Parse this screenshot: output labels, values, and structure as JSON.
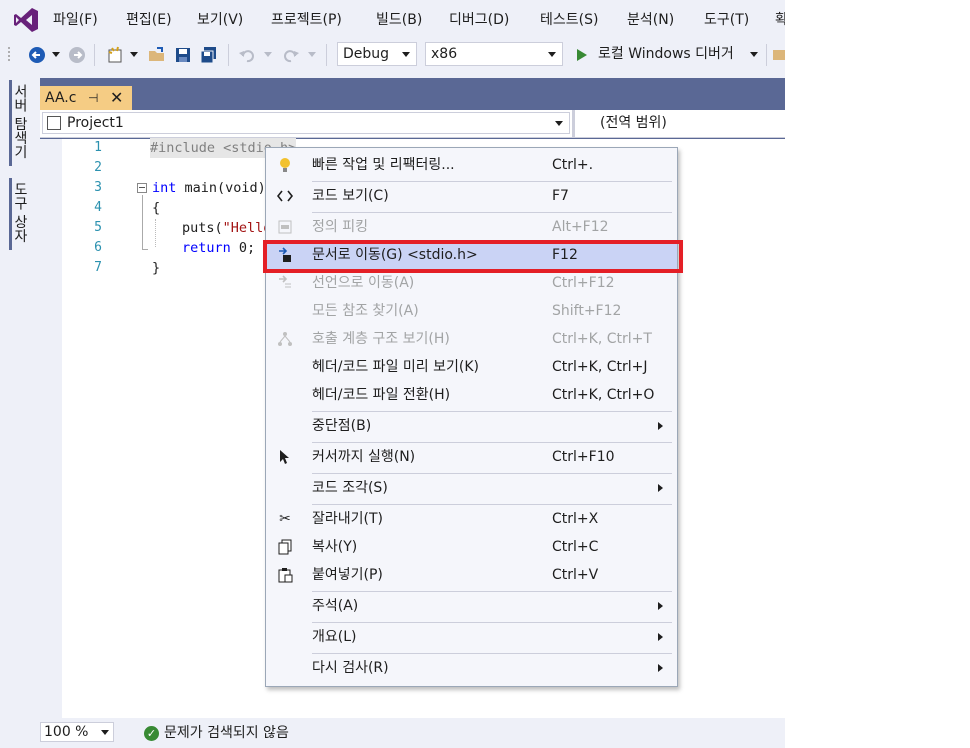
{
  "menubar": {
    "items": [
      "파일(F)",
      "편집(E)",
      "보기(V)",
      "프로젝트(P)",
      "빌드(B)",
      "디버그(D)",
      "테스트(S)",
      "분석(N)",
      "도구(T)",
      "확"
    ]
  },
  "toolbar": {
    "config": "Debug",
    "platform": "x86",
    "run_label": "로컬 Windows 디버거"
  },
  "sidebar": {
    "tabs": [
      "서버 탐색기",
      "도구 상자"
    ]
  },
  "document": {
    "tab_title": "AA.c",
    "nav_project": "Project1",
    "nav_scope": "(전역 범위)"
  },
  "editor": {
    "line_numbers": [
      "1",
      "2",
      "3",
      "4",
      "5",
      "6",
      "7"
    ],
    "lines": {
      "l1": "#include <stdio.h>",
      "l3_kw": "int",
      "l3_rest": " main(void)",
      "l4": "{",
      "l5_fn": "puts(",
      "l5_str": "\"Hello",
      "l6_kw": "return",
      "l6_rest": " 0;",
      "l7": "}"
    }
  },
  "context_menu": {
    "items": [
      {
        "label": "빠른 작업 및 리팩터링...",
        "shortcut": "Ctrl+.",
        "icon": "lightbulb-icon"
      },
      {
        "label": "코드 보기(C)",
        "shortcut": "F7",
        "icon": "code-icon"
      },
      {
        "label": "정의 피킹",
        "shortcut": "Alt+F12",
        "icon": "peek-definition-icon"
      },
      {
        "label": "문서로 이동(G) <stdio.h>",
        "shortcut": "F12",
        "icon": "go-to-document-icon"
      },
      {
        "label": "선언으로 이동(A)",
        "shortcut": "Ctrl+F12",
        "icon": "go-to-declaration-icon"
      },
      {
        "label": "모든 참조 찾기(A)",
        "shortcut": "Shift+F12",
        "icon": ""
      },
      {
        "label": "호출 계층 구조 보기(H)",
        "shortcut": "Ctrl+K, Ctrl+T",
        "icon": "call-hierarchy-icon"
      },
      {
        "label": "헤더/코드 파일 미리 보기(K)",
        "shortcut": "Ctrl+K, Ctrl+J",
        "icon": ""
      },
      {
        "label": "헤더/코드 파일 전환(H)",
        "shortcut": "Ctrl+K, Ctrl+O",
        "icon": ""
      },
      {
        "label": "중단점(B)",
        "shortcut": "",
        "icon": ""
      },
      {
        "label": "커서까지 실행(N)",
        "shortcut": "Ctrl+F10",
        "icon": "run-to-cursor-icon"
      },
      {
        "label": "코드 조각(S)",
        "shortcut": "",
        "icon": ""
      },
      {
        "label": "잘라내기(T)",
        "shortcut": "Ctrl+X",
        "icon": "scissors-icon"
      },
      {
        "label": "복사(Y)",
        "shortcut": "Ctrl+C",
        "icon": "copy-icon"
      },
      {
        "label": "붙여넣기(P)",
        "shortcut": "Ctrl+V",
        "icon": "paste-icon"
      },
      {
        "label": "주석(A)",
        "shortcut": "",
        "icon": ""
      },
      {
        "label": "개요(L)",
        "shortcut": "",
        "icon": ""
      },
      {
        "label": "다시 검사(R)",
        "shortcut": "",
        "icon": ""
      }
    ]
  },
  "statusbar": {
    "zoom": "100 %",
    "issues": "문제가 검색되지 않음"
  },
  "colors": {
    "accent": "#68217a",
    "highlight_border": "#e41f26",
    "menu_hover": "#cad3f5"
  }
}
